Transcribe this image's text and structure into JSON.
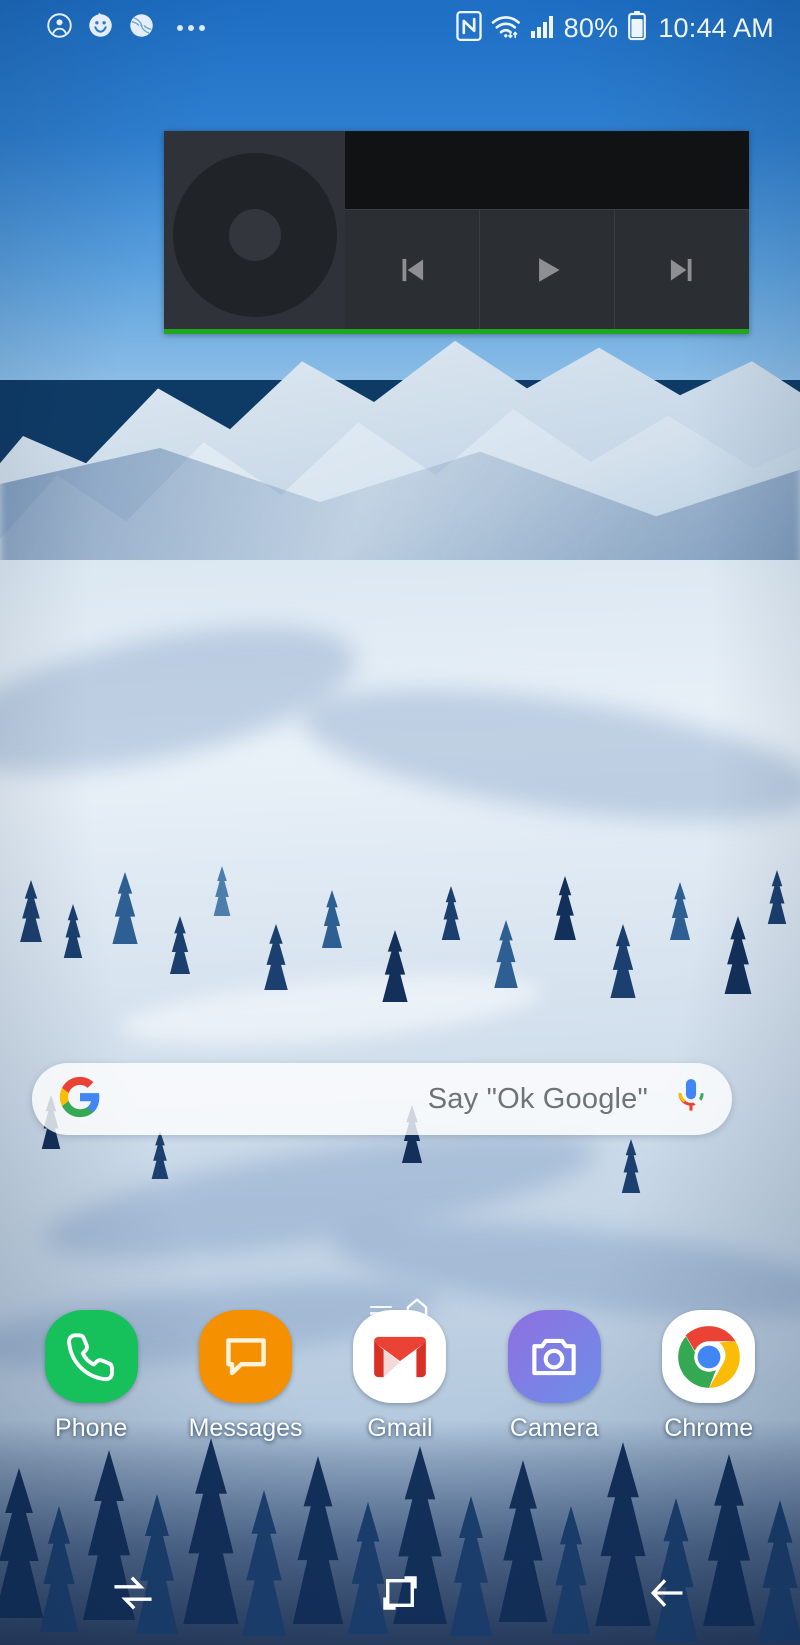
{
  "status_bar": {
    "left_icons": [
      {
        "name": "account-circle-icon",
        "glyph": "account"
      },
      {
        "name": "baby-face-icon",
        "glyph": "baby"
      },
      {
        "name": "baseball-icon",
        "glyph": "baseball"
      },
      {
        "name": "more-notifications-icon",
        "glyph": "dots"
      }
    ],
    "nfc_label": "NFC",
    "wifi_label": "WiFi",
    "signal_label": "Signal",
    "battery_percent": "80%",
    "battery_label": "Battery",
    "clock": "10:44 AM"
  },
  "media_widget": {
    "name": "music-player-widget",
    "track_title": "",
    "track_subtitle": "",
    "album_art_label": "Album art",
    "previous_label": "Previous",
    "play_label": "Play",
    "next_label": "Next",
    "progress_percent": 100,
    "progress_color": "#1fa81f",
    "background_color": "#2b2e33",
    "info_background_color": "#111214"
  },
  "search": {
    "name": "google-search-bar",
    "placeholder": "Say \"Ok Google\"",
    "logo_label": "Google",
    "mic_label": "Voice search"
  },
  "page_indicator": {
    "home_page_label": "Home screen",
    "pages": 2,
    "current": 1
  },
  "dock": {
    "items": [
      {
        "label": "Phone",
        "icon": "phone-icon",
        "color": "#16c05a"
      },
      {
        "label": "Messages",
        "icon": "messages-icon",
        "color": "#f59000"
      },
      {
        "label": "Gmail",
        "icon": "gmail-icon",
        "color": "#ffffff"
      },
      {
        "label": "Camera",
        "icon": "camera-icon",
        "color": "#7b7ce0"
      },
      {
        "label": "Chrome",
        "icon": "chrome-icon",
        "color": "#ffffff"
      }
    ]
  },
  "nav_bar": {
    "recents_label": "Recents",
    "home_label": "Home",
    "back_label": "Back"
  },
  "theme": {
    "status_text_color": "#eef5fc",
    "wallpaper_sky": "#2e7fd0",
    "accent_green": "#1fa81f"
  }
}
